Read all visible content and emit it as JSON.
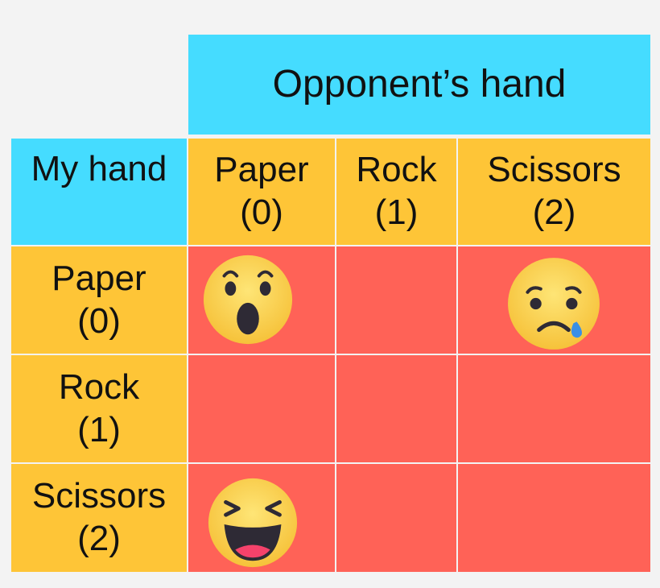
{
  "header": {
    "title": "Opponent’s hand"
  },
  "corner": {
    "label": "My hand"
  },
  "columns": [
    {
      "name": "Paper",
      "code": "(0)"
    },
    {
      "name": "Rock",
      "code": "(1)"
    },
    {
      "name": "Scissors",
      "code": "(2)"
    }
  ],
  "rows": [
    {
      "name": "Paper",
      "code": "(0)"
    },
    {
      "name": "Rock",
      "code": "(1)"
    },
    {
      "name": "Scissors",
      "code": "(2)"
    }
  ],
  "cells": [
    [
      "surprised-face-icon",
      "",
      "crying-face-icon"
    ],
    [
      "",
      "",
      ""
    ],
    [
      "laughing-face-icon",
      "",
      ""
    ]
  ],
  "colors": {
    "header": "#45dcff",
    "labels": "#fec537",
    "grid": "#ff6257",
    "emoji_face": "#fdd34a"
  }
}
